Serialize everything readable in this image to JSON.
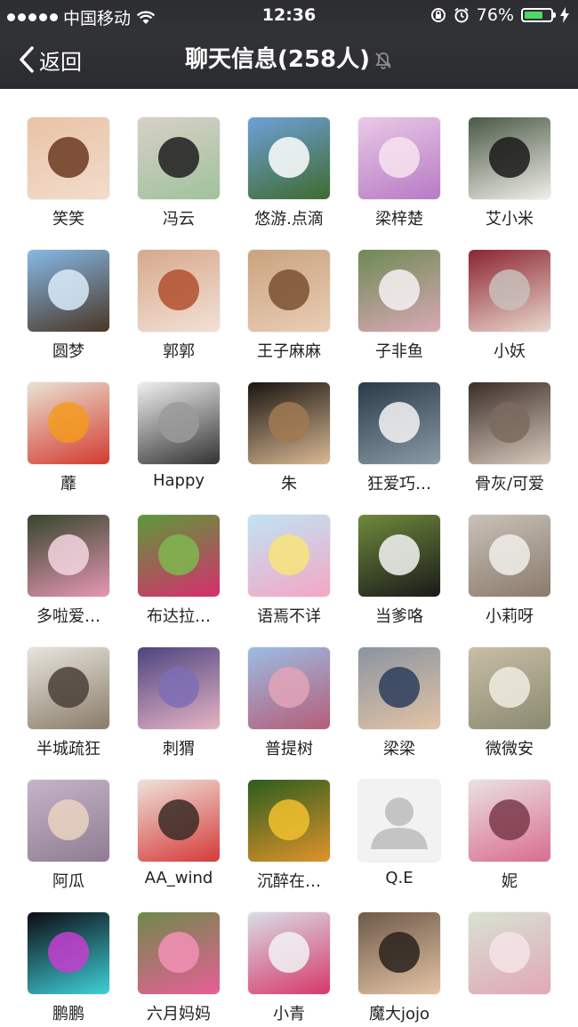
{
  "status": {
    "carrier": "中国移动",
    "time": "12:36",
    "battery": "76%",
    "battery_level": 0.76
  },
  "nav": {
    "back_label": "返回",
    "title": "聊天信息(258人)"
  },
  "members": [
    {
      "name": "笑笑",
      "colors": [
        "#e8c3a6",
        "#6b3a21",
        "#f3dccb"
      ]
    },
    {
      "name": "冯云",
      "colors": [
        "#d8d0c8",
        "#1d1d1d",
        "#9fc29a"
      ]
    },
    {
      "name": "悠游.点滴",
      "colors": [
        "#6da0d9",
        "#ffffff",
        "#3f6b2e"
      ]
    },
    {
      "name": "梁梓楚",
      "colors": [
        "#e9c9e6",
        "#f7e4ef",
        "#b77ac4"
      ]
    },
    {
      "name": "艾小米",
      "colors": [
        "#4b5946",
        "#1a1a1a",
        "#f0efe8"
      ]
    },
    {
      "name": "圆梦",
      "colors": [
        "#86b9e8",
        "#d9ecfa",
        "#4b3624"
      ]
    },
    {
      "name": "郭郭",
      "colors": [
        "#d7a88b",
        "#b0502f",
        "#f2e1d6"
      ]
    },
    {
      "name": "王子麻麻",
      "colors": [
        "#c9a37e",
        "#7a5030",
        "#e9cdb5"
      ]
    },
    {
      "name": "子非鱼",
      "colors": [
        "#6d8a55",
        "#f6f1f3",
        "#d9a9b5"
      ]
    },
    {
      "name": "小妖",
      "colors": [
        "#8c2430",
        "#c8c0bb",
        "#e9d8ce"
      ]
    },
    {
      "name": "蘼",
      "colors": [
        "#e8e2d2",
        "#f39a1f",
        "#d33b30"
      ]
    },
    {
      "name": "Happy",
      "colors": [
        "#efefef",
        "#9a9a9a",
        "#333333"
      ]
    },
    {
      "name": "朱",
      "colors": [
        "#1a1511",
        "#a07a52",
        "#d9b893"
      ]
    },
    {
      "name": "狂爱巧…",
      "colors": [
        "#2a3a48",
        "#f4f4f4",
        "#8a9aa6"
      ]
    },
    {
      "name": "骨灰/可爱",
      "colors": [
        "#3a2e28",
        "#7b6a5e",
        "#d8c9bc"
      ]
    },
    {
      "name": "多啦爱…",
      "colors": [
        "#35462c",
        "#f3d6e0",
        "#e796b3"
      ]
    },
    {
      "name": "布达拉…",
      "colors": [
        "#5c9a3a",
        "#7eb94f",
        "#d62e6e"
      ]
    },
    {
      "name": "语焉不详",
      "colors": [
        "#bfe4f4",
        "#f7e57a",
        "#f4a6c4"
      ]
    },
    {
      "name": "当爹咯",
      "colors": [
        "#6f8a3b",
        "#f4f4f4",
        "#1a1a1a"
      ]
    },
    {
      "name": "小莉呀",
      "colors": [
        "#c9c1b8",
        "#f1eeea",
        "#8a7a6c"
      ]
    },
    {
      "name": "半城疏狂",
      "colors": [
        "#e7e5de",
        "#4a4038",
        "#8a7b68"
      ]
    },
    {
      "name": "刺猬",
      "colors": [
        "#4d4580",
        "#7c6db4",
        "#e6b3c4"
      ]
    },
    {
      "name": "普提树",
      "colors": [
        "#9bbce4",
        "#e2a5b7",
        "#b55d77"
      ]
    },
    {
      "name": "梁梁",
      "colors": [
        "#8a94a0",
        "#2b3d5c",
        "#e3c3a6"
      ]
    },
    {
      "name": "微微安",
      "colors": [
        "#c9bda6",
        "#f0ece2",
        "#8a8a70"
      ]
    },
    {
      "name": "阿瓜",
      "colors": [
        "#c5b4c9",
        "#ead3c1",
        "#8f7c92"
      ]
    },
    {
      "name": "AA_wind",
      "colors": [
        "#eee2d8",
        "#3a2a24",
        "#d53a3a"
      ]
    },
    {
      "name": "沉醉在…",
      "colors": [
        "#2b5d1f",
        "#f1c12e",
        "#e0932a"
      ]
    },
    {
      "name": "Q.E",
      "colors": [
        "#f2f2f2",
        "#c8c8c8",
        "#c8c8c8"
      ]
    },
    {
      "name": "妮",
      "colors": [
        "#e9e1e2",
        "#7a3a4a",
        "#d96d8e"
      ]
    },
    {
      "name": "鹏鹏",
      "colors": [
        "#0c0b12",
        "#c63ed0",
        "#3fd0d8"
      ]
    },
    {
      "name": "六月妈妈",
      "colors": [
        "#6e8a4a",
        "#f290b6",
        "#e75f97"
      ]
    },
    {
      "name": "小青",
      "colors": [
        "#d9dde6",
        "#f2f2f4",
        "#d6396a"
      ]
    },
    {
      "name": "魔大jojo",
      "colors": [
        "#6e5a48",
        "#2a221c",
        "#e3c3a6"
      ]
    },
    {
      "name": "",
      "colors": [
        "#d7e2d2",
        "#f4e4e6",
        "#e1a7b7"
      ]
    }
  ]
}
